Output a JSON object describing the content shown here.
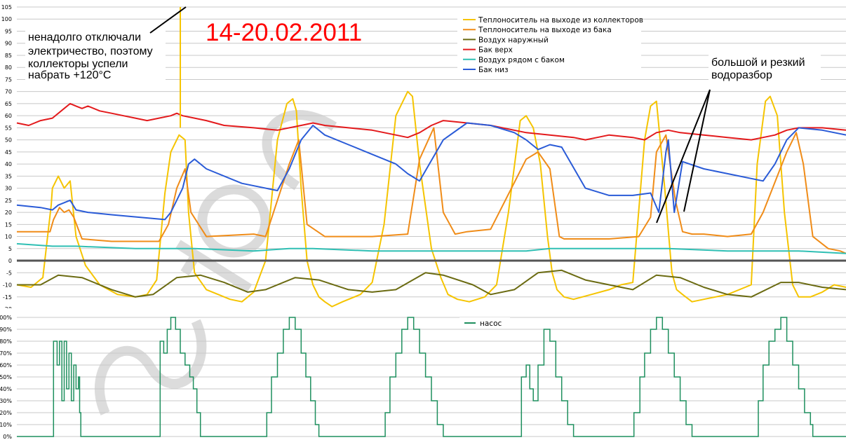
{
  "chart_data": [
    {
      "type": "line",
      "title": "14-20.02.2011",
      "ylim": [
        -20,
        105
      ],
      "yticks": [
        -20,
        -15,
        -10,
        -5,
        0,
        5,
        10,
        15,
        20,
        25,
        30,
        35,
        40,
        45,
        50,
        55,
        60,
        65,
        70,
        75,
        80,
        85,
        90,
        95,
        100,
        105
      ],
      "grid": true,
      "legend": "top-center",
      "x_unit": "day",
      "x_range": [
        0,
        7
      ],
      "series": [
        {
          "name": "Теплоноситель на выходе из коллекторов",
          "color": "#f5c400",
          "x": [
            0,
            0.12,
            0.22,
            0.29,
            0.3,
            0.35,
            0.38,
            0.4,
            0.45,
            0.5,
            0.58,
            0.7,
            0.85,
            1,
            1.1,
            1.18,
            1.25,
            1.3,
            1.37,
            1.42,
            1.45,
            1.5,
            1.6,
            1.7,
            1.8,
            1.9,
            2,
            2.1,
            2.2,
            2.28,
            2.33,
            2.36,
            2.4,
            2.45,
            2.5,
            2.55,
            2.6,
            2.66,
            2.75,
            2.9,
            3,
            3.1,
            3.2,
            3.3,
            3.34,
            3.4,
            3.5,
            3.58,
            3.64,
            3.72,
            3.82,
            3.95,
            4.05,
            4.15,
            4.25,
            4.3,
            4.36,
            4.42,
            4.48,
            4.52,
            4.56,
            4.62,
            4.7,
            4.85,
            5,
            5.1,
            5.2,
            5.3,
            5.35,
            5.4,
            5.47,
            5.53,
            5.57,
            5.62,
            5.7,
            5.8,
            6,
            6.2,
            6.25,
            6.32,
            6.36,
            6.42,
            6.48,
            6.55,
            6.6,
            6.7,
            6.8,
            6.9,
            7
          ],
          "y": [
            -10,
            -11,
            -7,
            23,
            30,
            35,
            32,
            30,
            33,
            10,
            -2,
            -10,
            -14,
            -15,
            -14,
            -8,
            28,
            45,
            52,
            50,
            20,
            -5,
            -12,
            -14,
            -16,
            -17,
            -13,
            0,
            50,
            65,
            67,
            62,
            30,
            0,
            -10,
            -15,
            -17,
            -19,
            -17,
            -14,
            -9,
            15,
            60,
            70,
            68,
            40,
            5,
            -7,
            -14,
            -16,
            -17,
            -15,
            -10,
            20,
            58,
            60,
            55,
            40,
            10,
            -5,
            -12,
            -15,
            -16,
            -14,
            -12,
            -10,
            -9,
            50,
            64,
            66,
            30,
            -5,
            -12,
            -14,
            -17,
            -16,
            -14,
            -10,
            40,
            66,
            68,
            60,
            20,
            -10,
            -15,
            -15,
            -13,
            -10,
            -11
          ]
        },
        {
          "name": "Теплоноситель на выходе из бака",
          "color": "#f08c18",
          "x": [
            0,
            0.28,
            0.31,
            0.36,
            0.4,
            0.44,
            0.48,
            0.55,
            0.8,
            1.2,
            1.28,
            1.35,
            1.42,
            1.47,
            1.6,
            2,
            2.1,
            2.3,
            2.38,
            2.45,
            2.6,
            3,
            3.3,
            3.4,
            3.52,
            3.6,
            3.7,
            3.8,
            4,
            4.3,
            4.4,
            4.5,
            4.58,
            4.62,
            4.7,
            5,
            5.25,
            5.35,
            5.4,
            5.48,
            5.56,
            5.62,
            5.7,
            5.8,
            6,
            6.2,
            6.3,
            6.5,
            6.58,
            6.64,
            6.72,
            6.85,
            6.95,
            7
          ],
          "y": [
            12,
            12,
            17,
            22,
            20,
            21,
            18,
            9,
            8,
            8,
            15,
            30,
            38,
            20,
            10,
            11,
            10,
            40,
            50,
            15,
            10,
            10,
            11,
            42,
            55,
            20,
            11,
            12,
            13,
            42,
            45,
            38,
            10,
            9,
            9,
            9,
            10,
            18,
            45,
            52,
            25,
            12,
            11,
            11,
            10,
            11,
            20,
            45,
            53,
            40,
            10,
            5,
            4,
            3
          ]
        },
        {
          "name": "Воздух наружный",
          "color": "#6b6b12",
          "x": [
            0,
            0.2,
            0.35,
            0.55,
            0.8,
            1,
            1.15,
            1.35,
            1.55,
            1.75,
            1.95,
            2.1,
            2.35,
            2.55,
            2.8,
            3,
            3.2,
            3.45,
            3.6,
            3.85,
            4,
            4.2,
            4.4,
            4.6,
            4.8,
            5,
            5.2,
            5.4,
            5.6,
            5.8,
            6,
            6.2,
            6.45,
            6.6,
            6.8,
            7
          ],
          "y": [
            -10,
            -10,
            -6,
            -7,
            -12,
            -15,
            -14,
            -7,
            -6,
            -9,
            -13,
            -12,
            -7,
            -8,
            -12,
            -13,
            -12,
            -5,
            -6,
            -10,
            -14,
            -12,
            -5,
            -4,
            -8,
            -10,
            -12,
            -6,
            -7,
            -11,
            -14,
            -15,
            -9,
            -9,
            -11,
            -12
          ]
        },
        {
          "name": "Бак верх",
          "color": "#e31a1c",
          "x": [
            0,
            0.1,
            0.2,
            0.3,
            0.4,
            0.45,
            0.5,
            0.55,
            0.6,
            0.7,
            0.8,
            0.9,
            1,
            1.1,
            1.2,
            1.3,
            1.35,
            1.4,
            1.5,
            1.6,
            1.75,
            2,
            2.2,
            2.4,
            2.5,
            2.6,
            2.8,
            3,
            3.2,
            3.3,
            3.4,
            3.5,
            3.6,
            3.8,
            4,
            4.3,
            4.5,
            4.7,
            4.8,
            4.9,
            5,
            5.2,
            5.3,
            5.4,
            5.5,
            5.6,
            5.8,
            6,
            6.2,
            6.3,
            6.4,
            6.5,
            6.6,
            6.8,
            7
          ],
          "y": [
            57,
            56,
            58,
            59,
            63,
            65,
            64,
            63,
            64,
            62,
            61,
            60,
            59,
            58,
            59,
            60,
            61,
            60,
            59,
            58,
            56,
            55,
            54,
            56,
            57,
            56,
            55,
            54,
            52,
            51,
            53,
            56,
            58,
            57,
            56,
            53,
            52,
            51,
            50,
            51,
            52,
            51,
            50,
            53,
            54,
            53,
            52,
            51,
            50,
            51,
            52,
            54,
            55,
            55,
            54
          ]
        },
        {
          "name": "Воздух рядом с баком",
          "color": "#2fbfb4",
          "x": [
            0,
            0.3,
            0.5,
            1,
            1.3,
            1.5,
            2,
            2.3,
            2.5,
            3,
            3.3,
            3.5,
            4,
            4.3,
            4.5,
            5,
            5.3,
            5.5,
            6,
            6.3,
            6.6,
            7
          ],
          "y": [
            7,
            6,
            6,
            5,
            5,
            5,
            4,
            5,
            5,
            4,
            4,
            4,
            4,
            4,
            5,
            5,
            5,
            5,
            4,
            4,
            4,
            3
          ]
        },
        {
          "name": "Бак низ",
          "color": "#2a5bd7",
          "x": [
            0,
            0.2,
            0.3,
            0.35,
            0.4,
            0.45,
            0.5,
            0.6,
            0.8,
            1.25,
            1.3,
            1.4,
            1.45,
            1.5,
            1.6,
            1.9,
            2.2,
            2.3,
            2.4,
            2.5,
            2.6,
            2.8,
            3,
            3.2,
            3.3,
            3.4,
            3.6,
            3.8,
            4,
            4.2,
            4.3,
            4.4,
            4.5,
            4.6,
            4.8,
            5,
            5.2,
            5.35,
            5.42,
            5.48,
            5.5,
            5.55,
            5.62,
            5.8,
            6,
            6.2,
            6.3,
            6.4,
            6.5,
            6.6,
            6.8,
            7
          ],
          "y": [
            23,
            22,
            21,
            23,
            24,
            25,
            21,
            20,
            19,
            17,
            20,
            30,
            40,
            42,
            38,
            32,
            29,
            38,
            50,
            56,
            52,
            48,
            44,
            40,
            36,
            33,
            50,
            57,
            56,
            53,
            50,
            46,
            48,
            47,
            30,
            27,
            27,
            28,
            20,
            45,
            50,
            20,
            41,
            38,
            36,
            34,
            33,
            40,
            50,
            55,
            54,
            52
          ]
        }
      ],
      "annotations": [
        {
          "lines": [
            "ненадолго отключали",
            "электричество, поэтому",
            "коллекторы успели",
            "набрать +120°С"
          ]
        },
        {
          "lines": [
            "большой и резкий",
            "водоразбор"
          ]
        }
      ]
    },
    {
      "type": "line",
      "ylim": [
        0,
        100
      ],
      "yticks": [
        "0%",
        "10%",
        "20%",
        "30%",
        "40%",
        "50%",
        "60%",
        "70%",
        "80%",
        "90%",
        "100%"
      ],
      "grid": true,
      "legend": "top-center",
      "x_unit": "day",
      "x_range": [
        0,
        7
      ],
      "series": [
        {
          "name": "насос",
          "color": "#1e8f5e",
          "x": [
            0,
            0.3,
            0.31,
            0.34,
            0.36,
            0.38,
            0.4,
            0.42,
            0.44,
            0.46,
            0.48,
            0.5,
            0.52,
            0.53,
            0.54,
            0.6,
            1.2,
            1.21,
            1.24,
            1.27,
            1.3,
            1.34,
            1.38,
            1.42,
            1.46,
            1.49,
            1.52,
            1.55,
            1.6,
            2,
            2.1,
            2.11,
            2.15,
            2.2,
            2.25,
            2.3,
            2.35,
            2.4,
            2.44,
            2.48,
            2.52,
            2.55,
            2.6,
            3,
            3.1,
            3.11,
            3.15,
            3.2,
            3.25,
            3.3,
            3.35,
            3.4,
            3.45,
            3.5,
            3.55,
            3.6,
            4,
            4.25,
            4.26,
            4.3,
            4.33,
            4.36,
            4.4,
            4.45,
            4.5,
            4.55,
            4.6,
            4.65,
            4.7,
            5,
            5.2,
            5.21,
            5.26,
            5.3,
            5.35,
            5.4,
            5.45,
            5.5,
            5.55,
            5.6,
            5.65,
            5.7,
            6,
            6.25,
            6.26,
            6.3,
            6.35,
            6.4,
            6.45,
            6.5,
            6.55,
            6.6,
            6.65,
            6.7,
            6.72,
            7
          ],
          "y": [
            0,
            0,
            80,
            60,
            80,
            30,
            80,
            40,
            70,
            30,
            60,
            40,
            50,
            20,
            0,
            0,
            0,
            80,
            70,
            90,
            100,
            90,
            70,
            60,
            50,
            40,
            20,
            0,
            0,
            0,
            0,
            20,
            50,
            70,
            90,
            100,
            90,
            70,
            50,
            30,
            10,
            0,
            0,
            0,
            0,
            20,
            50,
            70,
            90,
            100,
            90,
            70,
            50,
            30,
            10,
            0,
            0,
            0,
            50,
            60,
            40,
            30,
            60,
            90,
            80,
            50,
            30,
            10,
            0,
            0,
            0,
            20,
            50,
            70,
            90,
            100,
            90,
            70,
            50,
            30,
            10,
            0,
            0,
            0,
            30,
            60,
            80,
            90,
            100,
            80,
            60,
            40,
            20,
            10,
            0,
            0
          ]
        }
      ]
    }
  ]
}
